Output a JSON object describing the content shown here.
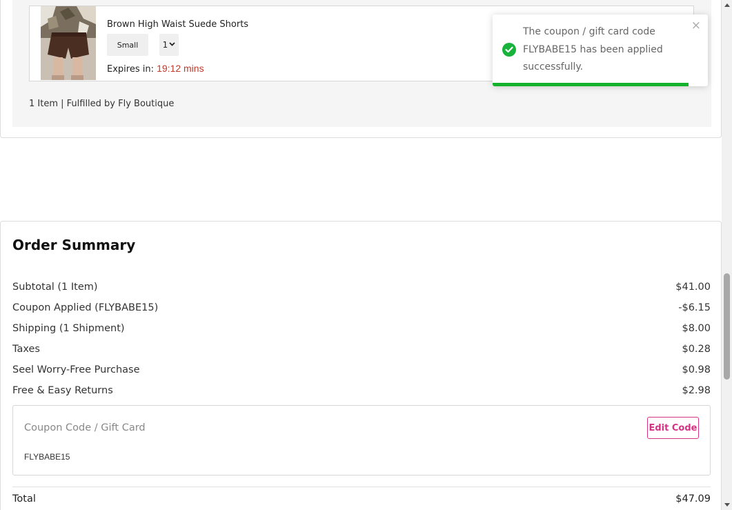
{
  "cart": {
    "item_name": "Brown High Waist Suede Shorts",
    "size_label": "Small",
    "quantity": "1",
    "expires_label": "Expires in:",
    "expires_time": "19:12 mins",
    "fulfilled_text": "1 Item | Fulfilled by Fly Boutique"
  },
  "toast": {
    "message": "The coupon / gift card code FLYBABE15 has been applied successfully.",
    "close_label": "×",
    "progress_fraction": 0.91,
    "success_color": "#18b33a"
  },
  "summary": {
    "title": "Order Summary",
    "rows": [
      {
        "label": "Subtotal (1 Item)",
        "value": "$41.00"
      },
      {
        "label": "Coupon Applied (FLYBABE15)",
        "value": "-$6.15"
      },
      {
        "label": "Shipping (1 Shipment)",
        "value": "$8.00"
      },
      {
        "label": "Taxes",
        "value": "$0.28"
      },
      {
        "label": "Seel Worry-Free Purchase",
        "value": "$0.98"
      },
      {
        "label": "Free & Easy Returns",
        "value": "$2.98"
      }
    ],
    "coupon_label": "Coupon Code / Gift Card",
    "edit_code_label": "Edit Code",
    "coupon_value": "FLYBABE15",
    "total_label": "Total",
    "total_value": "$47.09",
    "accent_color": "#d63384"
  },
  "icons": {
    "check": "check-circle-icon",
    "close": "close-icon",
    "chevron": "chevron-down-icon",
    "scroll_up": "scroll-up-arrow-icon",
    "scroll_down": "scroll-down-arrow-icon"
  }
}
